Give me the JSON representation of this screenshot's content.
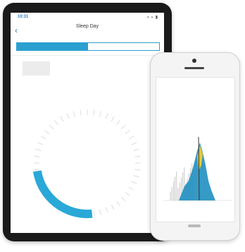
{
  "tablet": {
    "status": {
      "time": "10:31",
      "right": ""
    },
    "navbar": {
      "back_icon": "chevron-left-icon",
      "title": "Sleep Day",
      "subtitle": ""
    },
    "segments": {
      "active_label": "",
      "inactive_label": ""
    },
    "ring": {
      "arc_fraction": 0.24,
      "arc_color": "#2aa8d8",
      "tick_color": "#dcdcdc"
    }
  },
  "phone": {
    "navbar": {
      "back": "",
      "title": "",
      "action": ""
    },
    "chart": {
      "colors": {
        "blue": "#1f8fc0",
        "yellow": "#e3c73a",
        "gray": "#b7b7b7",
        "dark": "#333333"
      }
    }
  }
}
